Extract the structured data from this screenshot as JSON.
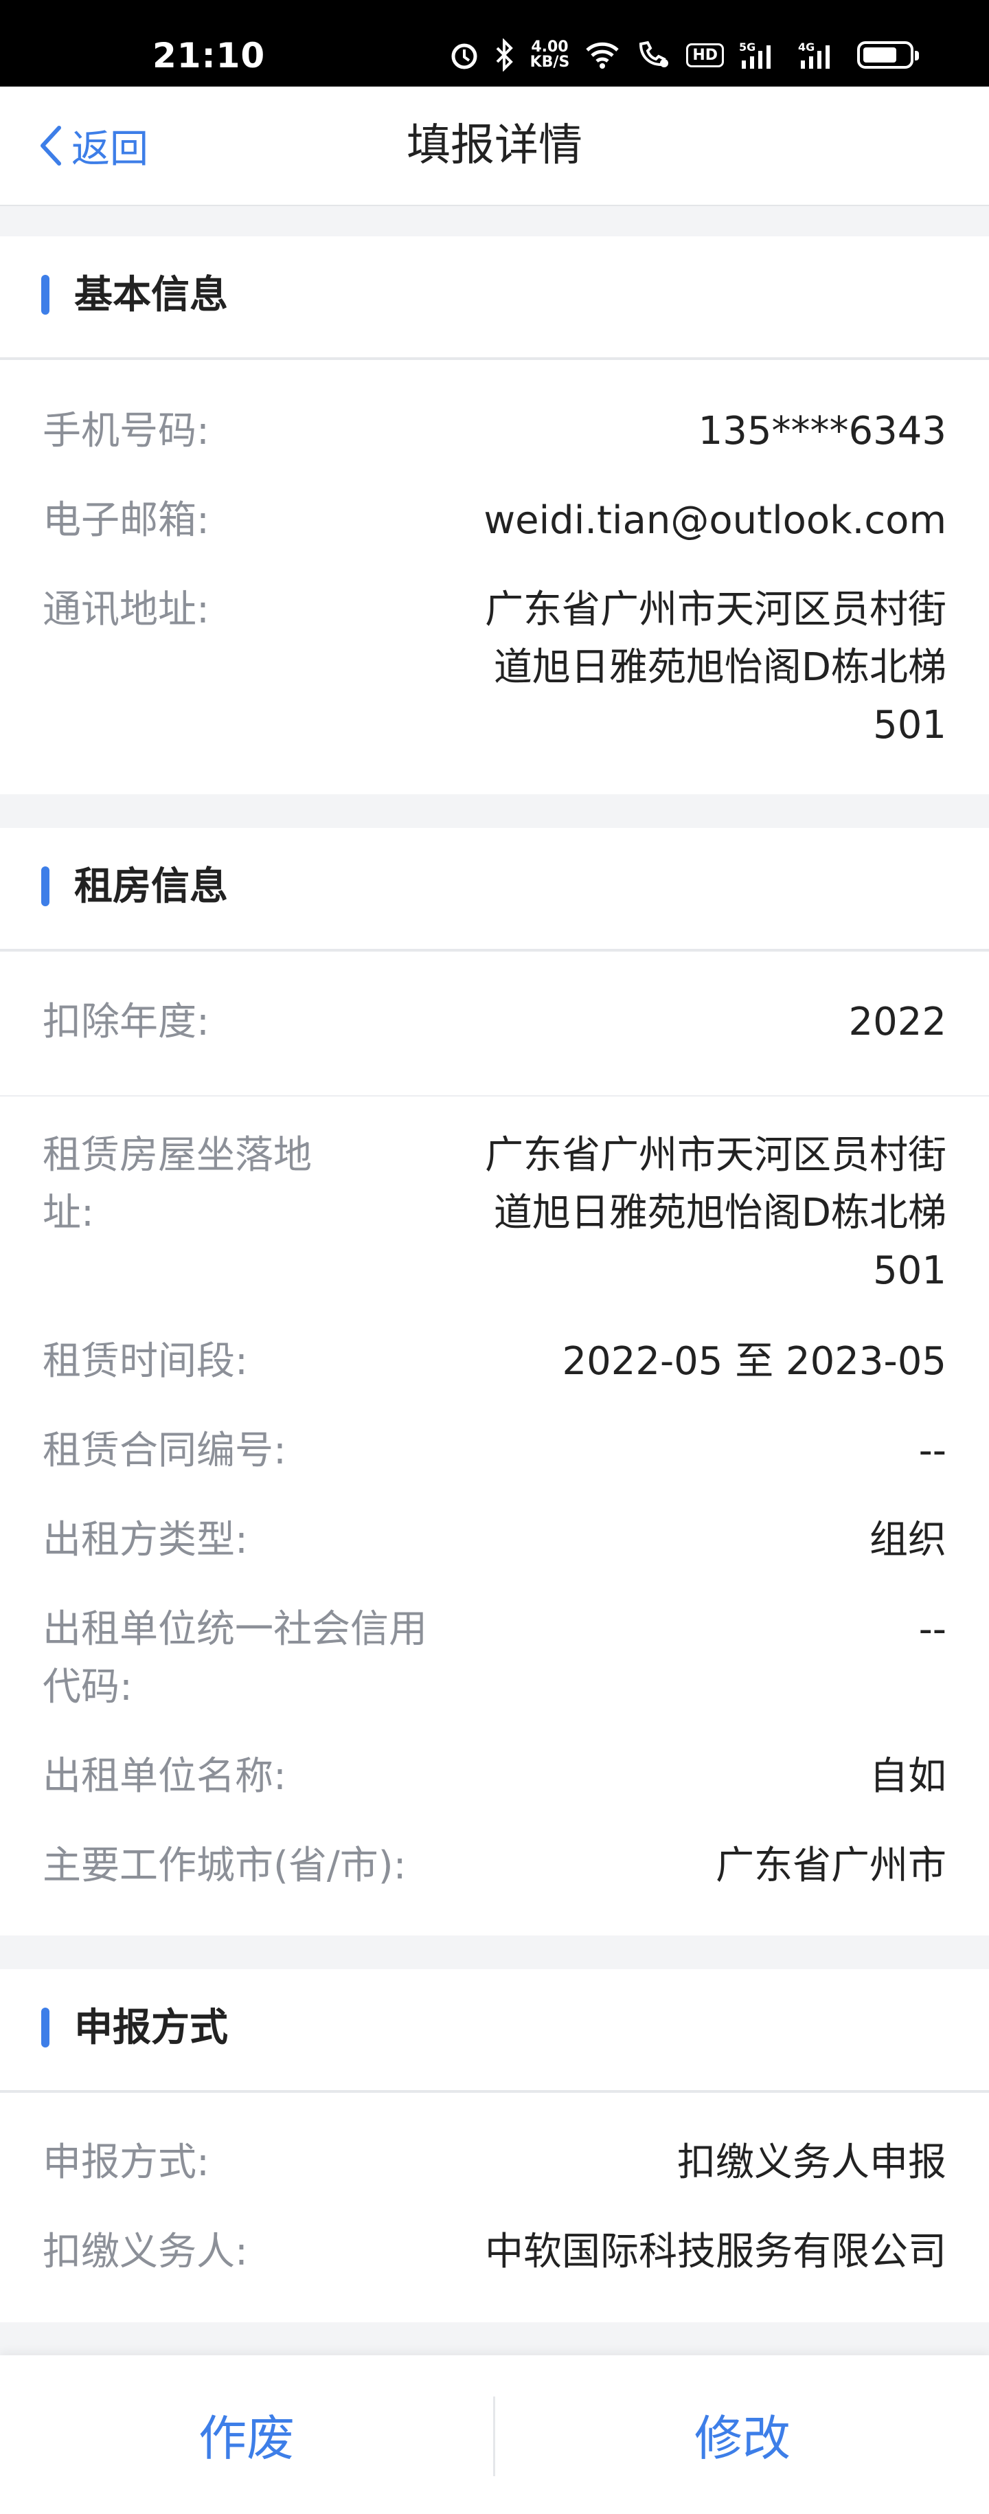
{
  "status_bar": {
    "time": "21:10",
    "net_speed_value": "4.00",
    "net_speed_unit": "KB/S",
    "hd_label": "HD",
    "signal1_label": "5G",
    "signal2_label": "4G"
  },
  "nav": {
    "back_label": "返回",
    "title": "填报详情"
  },
  "basic_info": {
    "title": "基本信息",
    "rows": [
      {
        "label": "手机号码:",
        "value": "135****6343"
      },
      {
        "label": "电子邮箱:",
        "value": "weidi.tian@outlook.com"
      },
      {
        "label": "通讯地址:",
        "value_lines": [
          "广东省广州市天河区员村街",
          "道旭日雅苑旭怡阁D栋北梯",
          "501"
        ]
      }
    ]
  },
  "rental_info": {
    "title": "租房信息",
    "rows": [
      {
        "label": "扣除年度:",
        "value": "2022"
      },
      {
        "label_lines": [
          "租赁房屋坐落地",
          "址:"
        ],
        "value_lines": [
          "广东省广州市天河区员村街",
          "道旭日雅苑旭怡阁D栋北梯",
          "501"
        ]
      },
      {
        "label": "租赁时间段:",
        "value": "2022-05 至 2023-05"
      },
      {
        "label": "租赁合同编号:",
        "value": "--"
      },
      {
        "label": "出租方类型:",
        "value": "组织"
      },
      {
        "label_lines": [
          "出租单位统一社会信用",
          "代码:"
        ],
        "value": "--"
      },
      {
        "label": "出租单位名称:",
        "value": "自如"
      },
      {
        "label": "主要工作城市(省/市):",
        "value": "广东省广州市"
      }
    ]
  },
  "declaration": {
    "title": "申报方式",
    "rows": [
      {
        "label": "申报方式:",
        "value": "扣缴义务人申报"
      },
      {
        "label": "扣缴义务人:",
        "value": "中软国际科技服务有限公司"
      }
    ]
  },
  "actions": {
    "void_label": "作废",
    "edit_label": "修改"
  },
  "colors": {
    "accent": "#3d7ee8",
    "label": "#8c9098",
    "value": "#222222",
    "background": "#f3f4f6"
  }
}
